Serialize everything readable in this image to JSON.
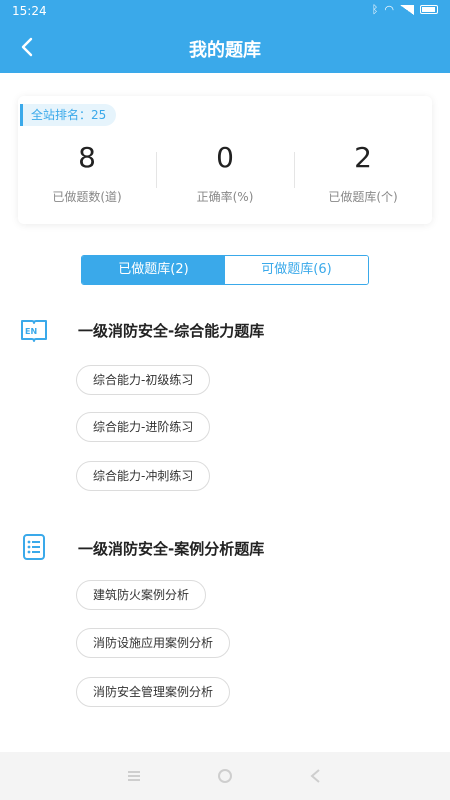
{
  "status_bar": {
    "time": "15:24"
  },
  "header": {
    "title": "我的题库"
  },
  "rank": {
    "label": "全站排名：25"
  },
  "stats": [
    {
      "value": "8",
      "label": "已做题数(道)"
    },
    {
      "value": "0",
      "label": "正确率(%)"
    },
    {
      "value": "2",
      "label": "已做题库(个)"
    }
  ],
  "tabs": [
    {
      "label": "已做题库(2)",
      "active": true
    },
    {
      "label": "可做题库(6)",
      "active": false
    }
  ],
  "sections": [
    {
      "icon": "book-en-icon",
      "icon_text": "EN",
      "title": "一级消防安全-综合能力题库",
      "items": [
        "综合能力-初级练习",
        "综合能力-进阶练习",
        "综合能力-冲刺练习"
      ]
    },
    {
      "icon": "list-icon",
      "title": "一级消防安全-案例分析题库",
      "items": [
        "建筑防火案例分析",
        "消防设施应用案例分析",
        "消防安全管理案例分析"
      ]
    }
  ],
  "colors": {
    "accent": "#3aa9ea",
    "header_bg": "#3aa9ea",
    "nav_bg": "#f4f4f4"
  }
}
